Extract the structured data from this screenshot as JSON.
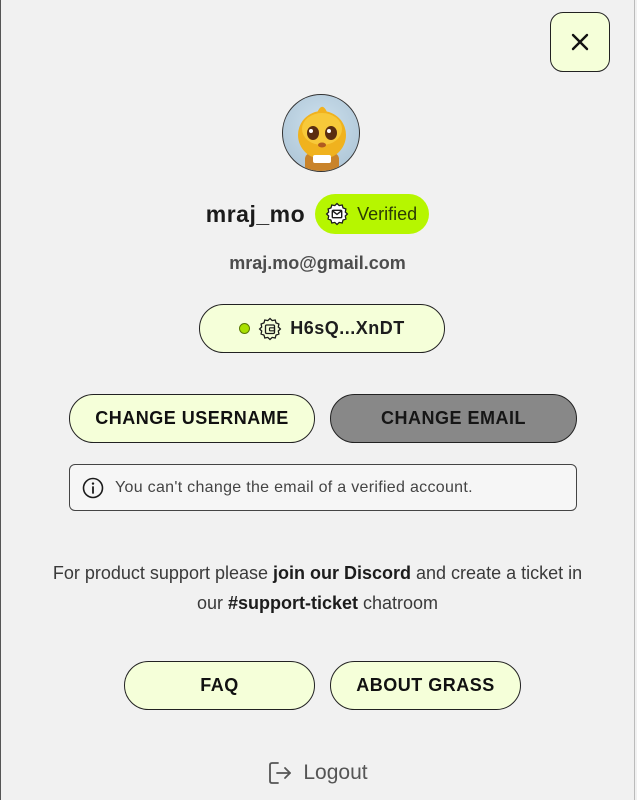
{
  "close": {
    "icon": "close-icon"
  },
  "profile": {
    "avatar_icon": "avatar-mascot",
    "username": "mraj_mo",
    "verified_label": "Verified",
    "verified_icon": "mail-badge-icon",
    "email": "mraj.mo@gmail.com"
  },
  "wallet": {
    "status_color": "#a8e000",
    "icon": "wallet-badge-icon",
    "address": "H6sQ...XnDT"
  },
  "actions": {
    "change_username": "CHANGE USERNAME",
    "change_email": "CHANGE EMAIL"
  },
  "notice": {
    "icon": "info-icon",
    "text": "You can't change the email of a verified account."
  },
  "support": {
    "prefix": "For product support please ",
    "link": "join our Discord",
    "middle": " and create a ticket in our ",
    "channel": "#support-ticket",
    "suffix": " chatroom"
  },
  "footer_buttons": {
    "faq": "FAQ",
    "about": "ABOUT GRASS"
  },
  "logout": {
    "icon": "logout-icon",
    "label": "Logout"
  },
  "colors": {
    "accent": "#b6f600",
    "button_light": "#f5ffd9",
    "button_disabled": "#888888"
  }
}
